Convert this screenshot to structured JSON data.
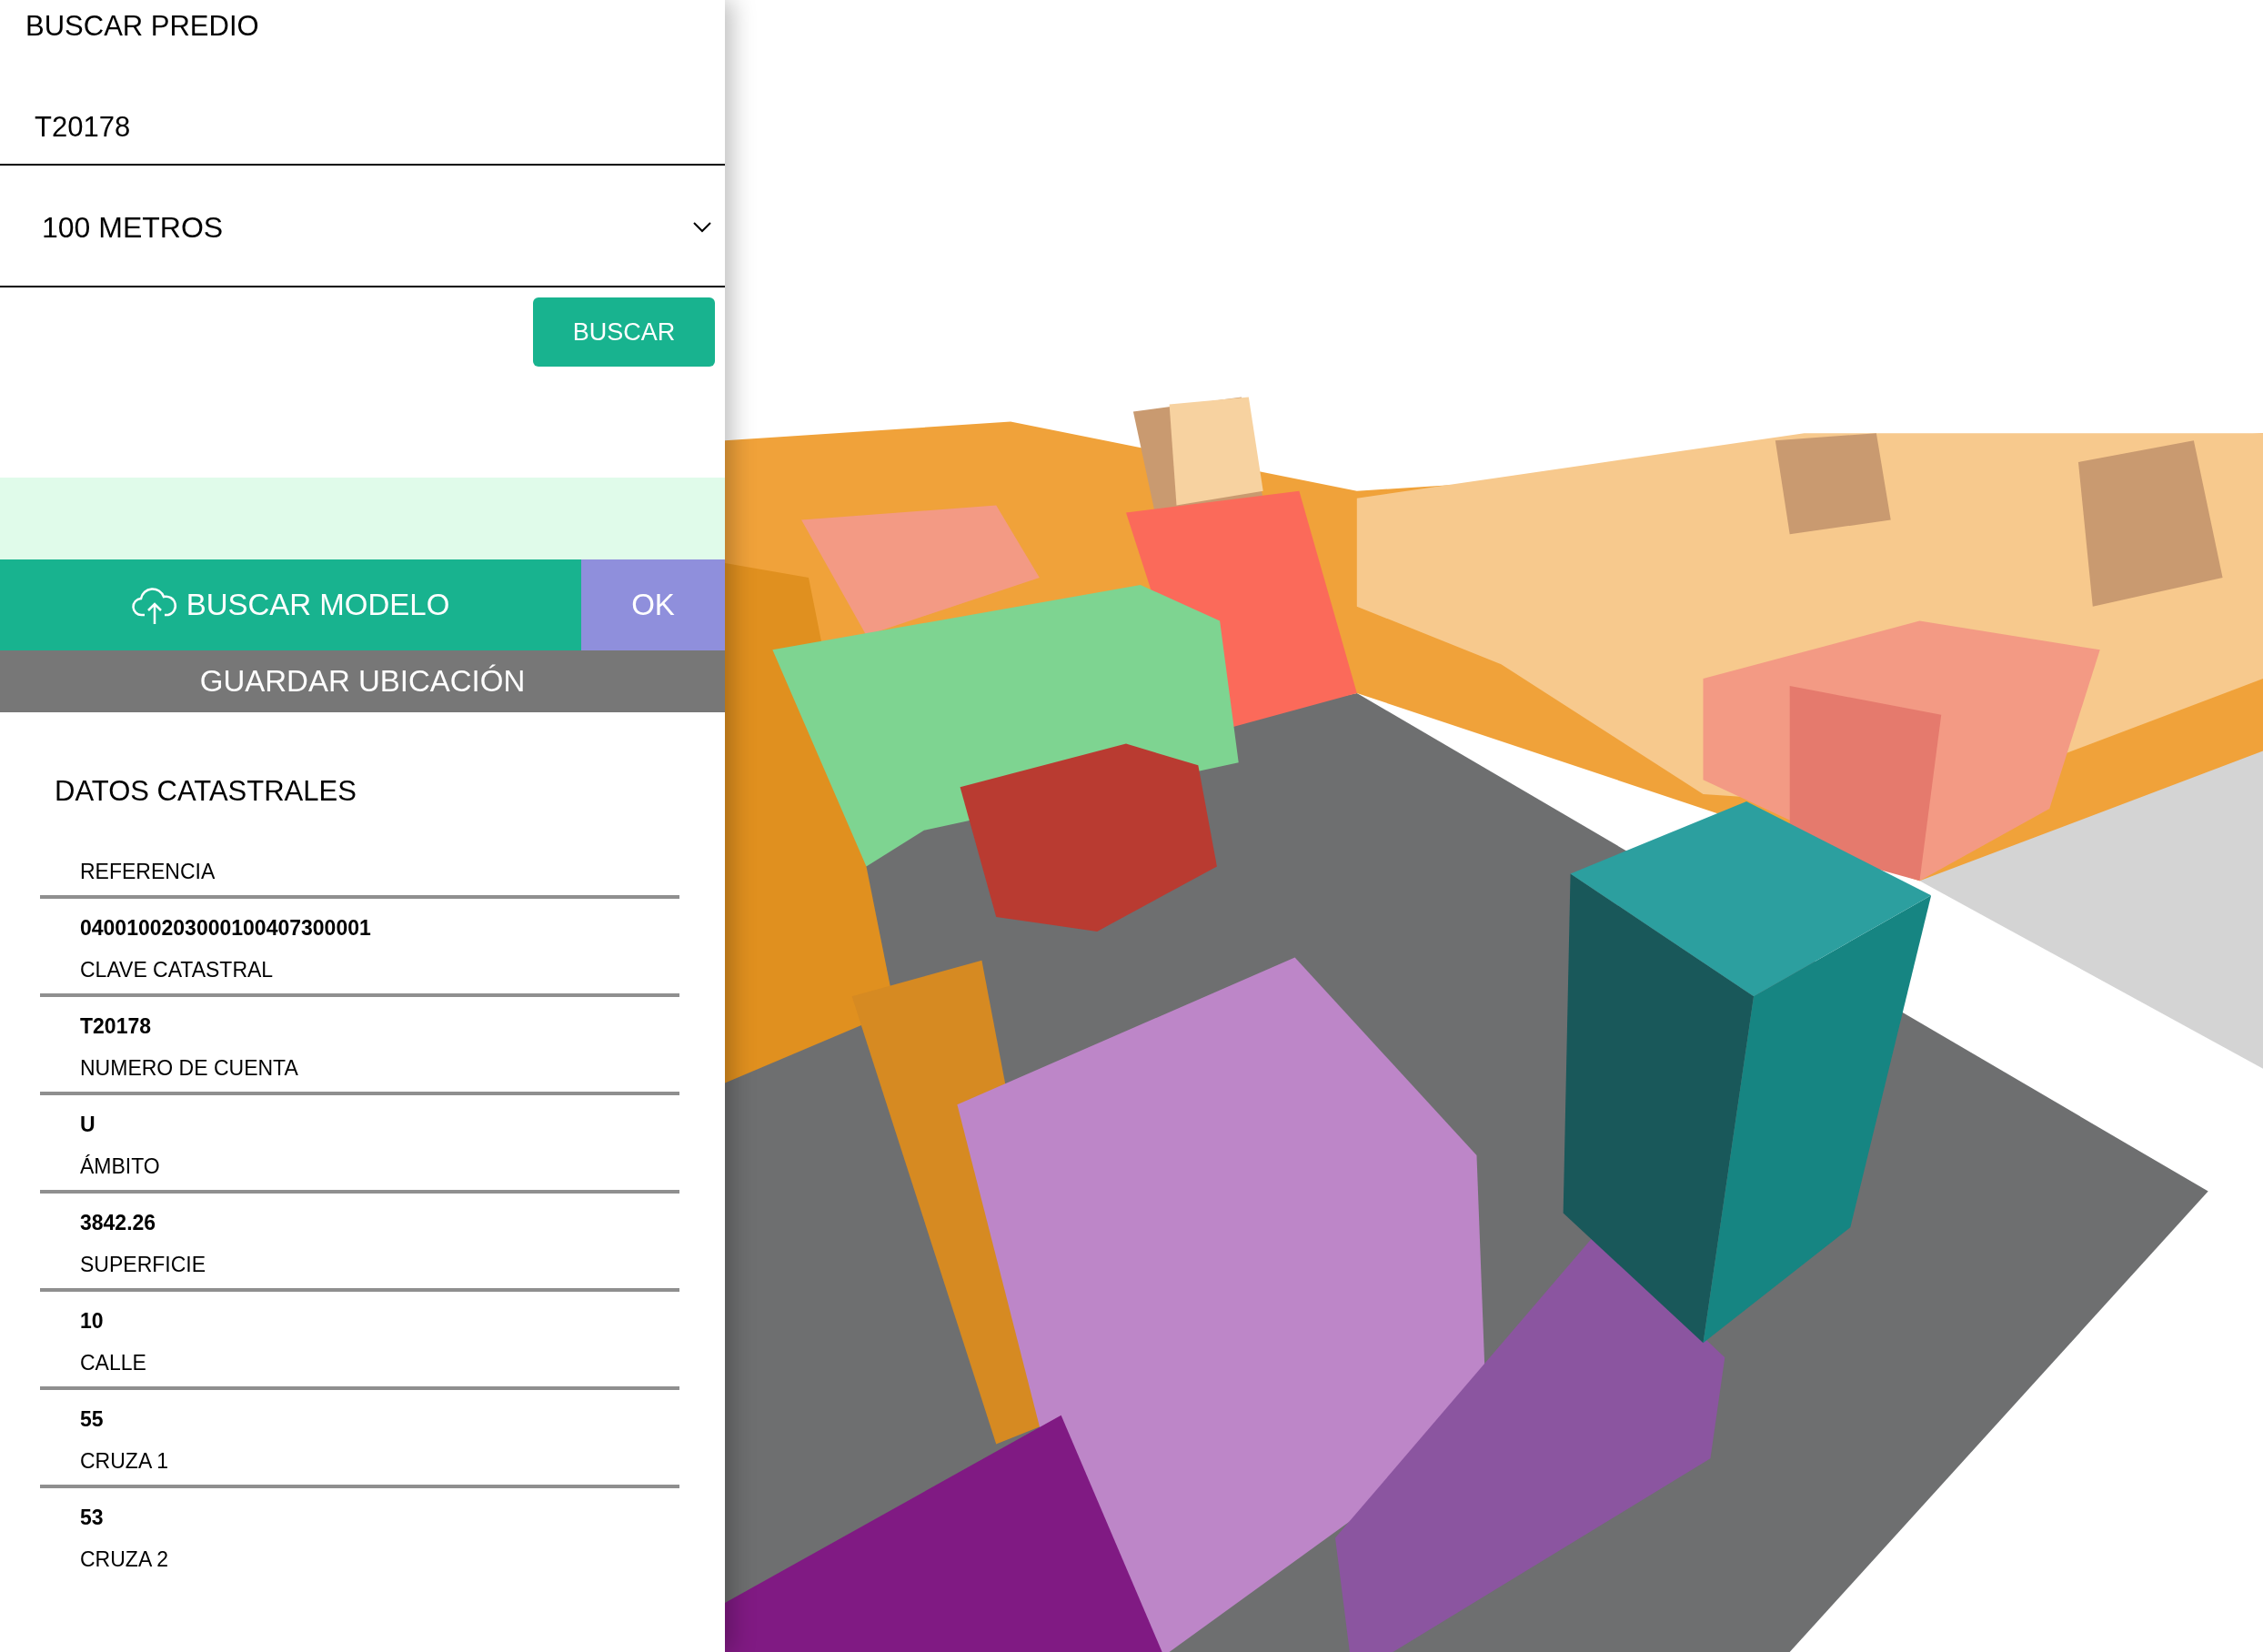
{
  "search": {
    "title": "BUSCAR PREDIO",
    "query": "T20178",
    "radius": "100 METROS",
    "button": "BUSCAR"
  },
  "actions": {
    "model_button": "BUSCAR MODELO",
    "ok_button": "OK",
    "save_button": "GUARDAR UBICACIÓN"
  },
  "cadastral": {
    "title": "DATOS CATASTRALES",
    "fields": [
      {
        "label": "REFERENCIA"
      },
      {
        "value": "0400100203000100407300001",
        "label": "CLAVE CATASTRAL"
      },
      {
        "value": "T20178",
        "label": "NUMERO DE CUENTA"
      },
      {
        "value": "U",
        "label": "ÁMBITO"
      },
      {
        "value": "3842.26",
        "label": "SUPERFICIE"
      },
      {
        "value": "10",
        "label": "CALLE"
      },
      {
        "value": "55",
        "label": "CRUZA 1"
      },
      {
        "value": "53",
        "label": "CRUZA 2"
      }
    ]
  }
}
